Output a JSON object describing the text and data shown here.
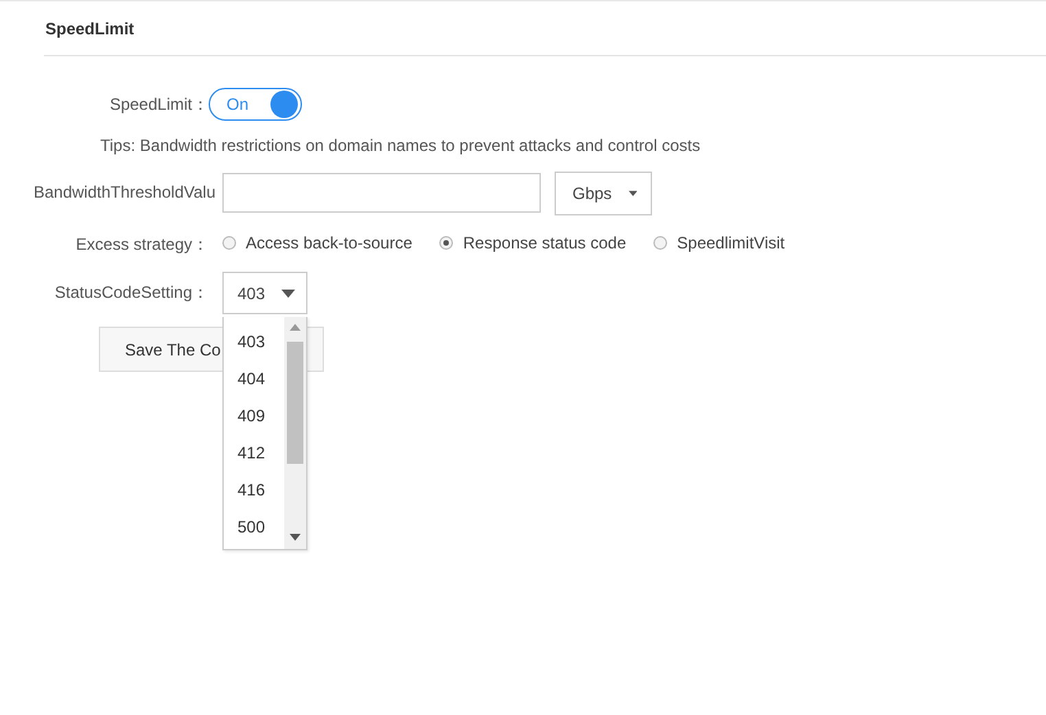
{
  "section_title": "SpeedLimit",
  "speed_limit": {
    "label": "SpeedLimit：",
    "toggle_text": "On",
    "on": true
  },
  "tips": "Tips: Bandwidth restrictions on domain names to prevent attacks and control costs",
  "bandwidth": {
    "label": "BandwidthThresholdValu",
    "unit": "Gbps"
  },
  "excess_strategy": {
    "label": "Excess strategy：",
    "options": [
      {
        "label": "Access back-to-source",
        "selected": false
      },
      {
        "label": "Response status code",
        "selected": true
      },
      {
        "label": "SpeedlimitVisit",
        "selected": false
      }
    ]
  },
  "status_code": {
    "label": "StatusCodeSetting：",
    "value": "403",
    "expanded": true,
    "options": [
      "403",
      "404",
      "409",
      "412",
      "416",
      "500"
    ]
  },
  "save_button": "Save The Co"
}
